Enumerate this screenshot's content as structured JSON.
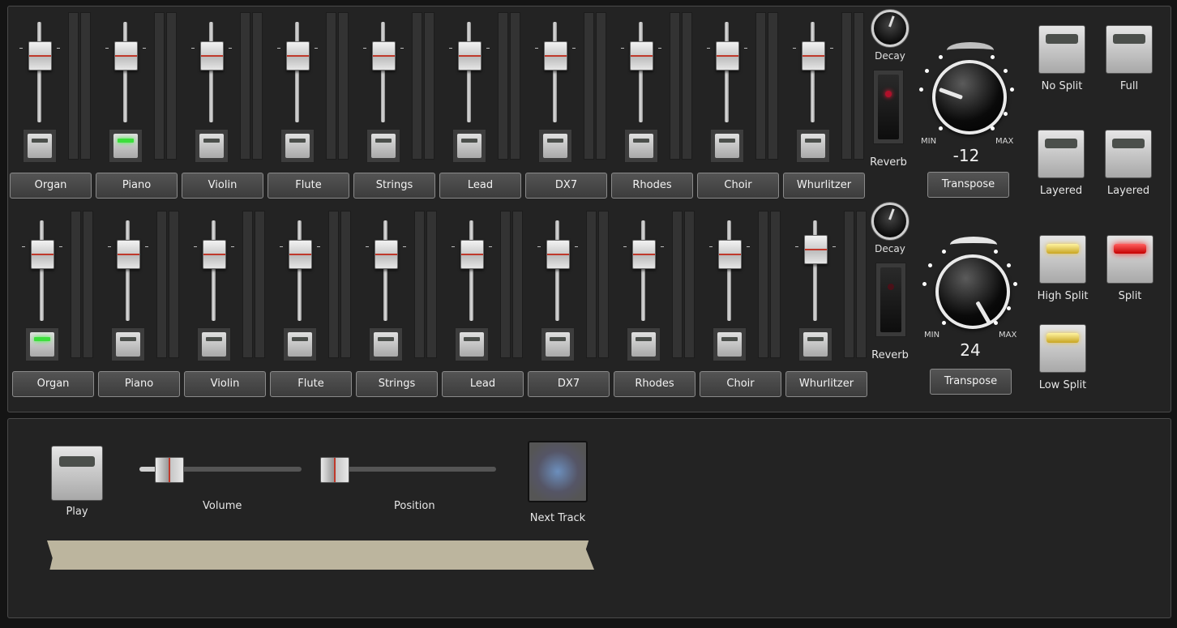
{
  "top_section": {
    "channels": [
      {
        "name": "Organ",
        "fader": 0.4,
        "led_on": false
      },
      {
        "name": "Piano",
        "fader": 0.4,
        "led_on": true
      },
      {
        "name": "Violin",
        "fader": 0.4,
        "led_on": false
      },
      {
        "name": "Flute",
        "fader": 0.4,
        "led_on": false
      },
      {
        "name": "Strings",
        "fader": 0.4,
        "led_on": false
      },
      {
        "name": "Lead",
        "fader": 0.4,
        "led_on": false
      },
      {
        "name": "DX7",
        "fader": 0.4,
        "led_on": false
      },
      {
        "name": "Rhodes",
        "fader": 0.4,
        "led_on": false
      },
      {
        "name": "Choir",
        "fader": 0.4,
        "led_on": false
      },
      {
        "name": "Whurlitzer",
        "fader": 0.4,
        "led_on": false
      }
    ],
    "decay_label": "Decay",
    "reverb_label": "Reverb",
    "knob_min": "MIN",
    "knob_max": "MAX",
    "knob_value": "-12",
    "transpose_label": "Transpose"
  },
  "bottom_section": {
    "channels": [
      {
        "name": "Organ",
        "fader": 0.4,
        "led_on": true
      },
      {
        "name": "Piano",
        "fader": 0.4,
        "led_on": false
      },
      {
        "name": "Violin",
        "fader": 0.4,
        "led_on": false
      },
      {
        "name": "Flute",
        "fader": 0.4,
        "led_on": false
      },
      {
        "name": "Strings",
        "fader": 0.4,
        "led_on": false
      },
      {
        "name": "Lead",
        "fader": 0.4,
        "led_on": false
      },
      {
        "name": "DX7",
        "fader": 0.4,
        "led_on": false
      },
      {
        "name": "Rhodes",
        "fader": 0.4,
        "led_on": false
      },
      {
        "name": "Choir",
        "fader": 0.4,
        "led_on": false
      },
      {
        "name": "Whurlitzer",
        "fader": 0.55,
        "led_on": false
      }
    ],
    "decay_label": "Decay",
    "reverb_label": "Reverb",
    "knob_min": "MIN",
    "knob_max": "MAX",
    "knob_value": "24",
    "transpose_label": "Transpose"
  },
  "split_buttons": [
    {
      "label": "No Split",
      "state": "off"
    },
    {
      "label": "Full",
      "state": "off"
    },
    {
      "label": "Layered",
      "state": "off"
    },
    {
      "label": "Layered",
      "state": "off"
    },
    {
      "label": "High Split",
      "state": "gold"
    },
    {
      "label": "Split",
      "state": "red"
    },
    {
      "label": "Low Split",
      "state": "gold"
    }
  ],
  "transport": {
    "play_label": "Play",
    "volume_label": "Volume",
    "volume_value": 0.18,
    "position_label": "Position",
    "position_value": 0.0,
    "next_track_label": "Next Track"
  }
}
